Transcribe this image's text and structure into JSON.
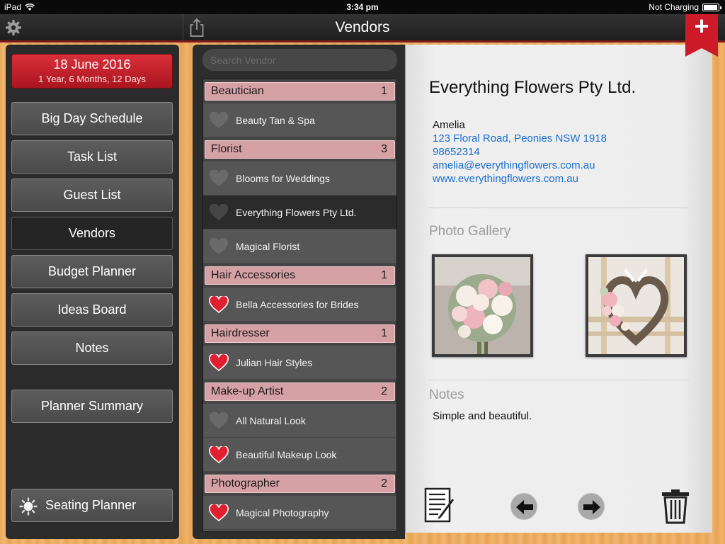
{
  "status": {
    "device": "iPad",
    "time": "3:34 pm",
    "battery_label": "Not Charging"
  },
  "header": {
    "title": "Vendors"
  },
  "sidebar": {
    "date": "18 June 2016",
    "countdown": "1 Year, 6 Months, 12 Days",
    "items": [
      {
        "label": "Big Day Schedule"
      },
      {
        "label": "Task List"
      },
      {
        "label": "Guest List"
      },
      {
        "label": "Vendors"
      },
      {
        "label": "Budget Planner"
      },
      {
        "label": "Ideas Board"
      },
      {
        "label": "Notes"
      },
      {
        "label": "Planner Summary"
      },
      {
        "label": "Seating Planner"
      }
    ]
  },
  "search": {
    "placeholder": "Search Vendor"
  },
  "vendor_list": [
    {
      "category": "Beautician",
      "count": "1",
      "vendors": [
        {
          "name": "Beauty Tan & Spa",
          "favorite": false
        }
      ]
    },
    {
      "category": "Florist",
      "count": "3",
      "vendors": [
        {
          "name": "Blooms for Weddings",
          "favorite": false
        },
        {
          "name": "Everything Flowers Pty Ltd.",
          "favorite": false,
          "selected": true
        },
        {
          "name": "Magical Florist",
          "favorite": false
        }
      ]
    },
    {
      "category": "Hair Accessories",
      "count": "1",
      "vendors": [
        {
          "name": "Bella Accessories for Brides",
          "favorite": true
        }
      ]
    },
    {
      "category": "Hairdresser",
      "count": "1",
      "vendors": [
        {
          "name": "Julian Hair Styles",
          "favorite": true
        }
      ]
    },
    {
      "category": "Make-up Artist",
      "count": "2",
      "vendors": [
        {
          "name": "All Natural Look",
          "favorite": false
        },
        {
          "name": "Beautiful Makeup Look",
          "favorite": true
        }
      ]
    },
    {
      "category": "Photographer",
      "count": "2",
      "vendors": [
        {
          "name": "Magical Photography",
          "favorite": true
        }
      ]
    }
  ],
  "detail": {
    "name": "Everything Flowers Pty Ltd.",
    "contact_name": "Amelia",
    "address": "123 Floral Road, Peonies NSW 1918",
    "phone": "98652314",
    "email": "amelia@everythingflowers.com.au",
    "website": "www.everythingflowers.com.au",
    "gallery_label": "Photo Gallery",
    "notes_label": "Notes",
    "notes_text": "Simple and beautiful."
  },
  "colors": {
    "accent": "#cc1a28",
    "category_pill": "#d6a1a5",
    "link": "#1a6fd1",
    "favorite_heart": "#e0202f"
  }
}
